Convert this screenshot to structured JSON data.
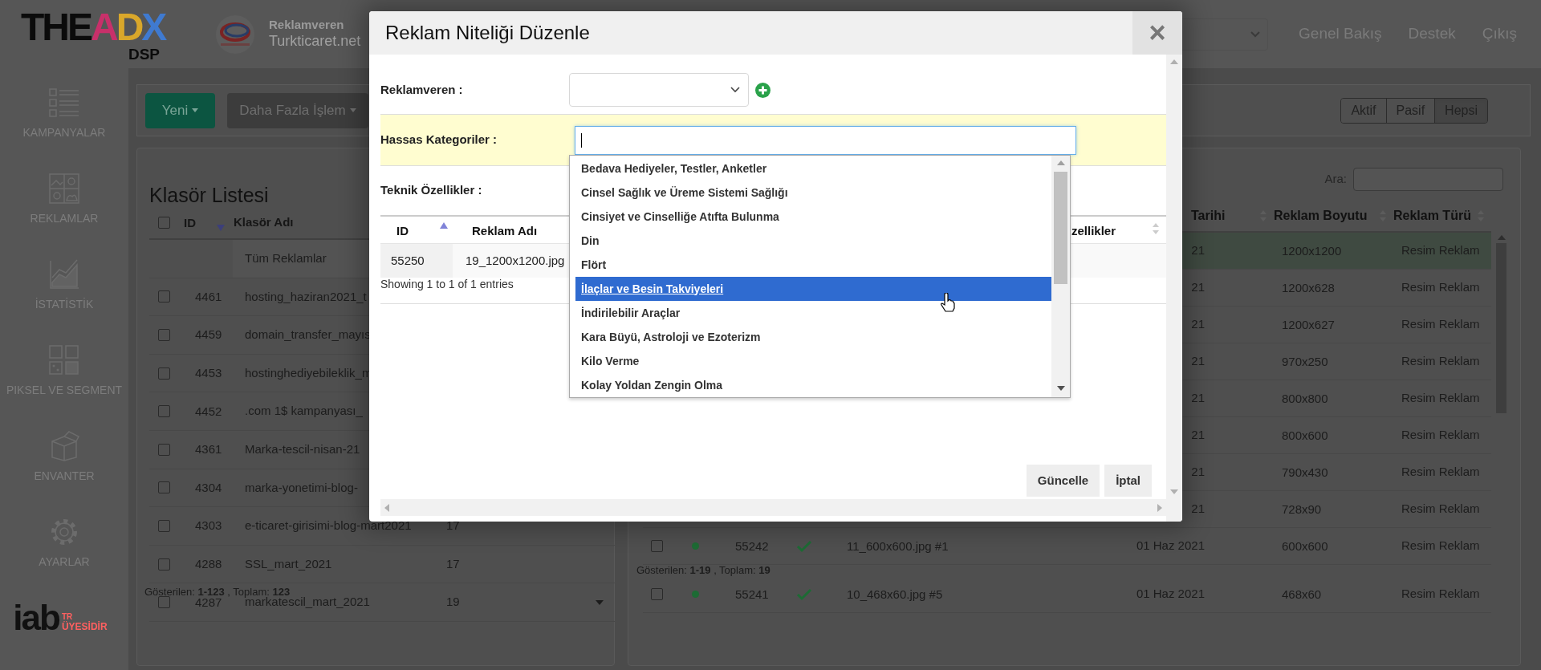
{
  "header": {
    "logo": "THEADX",
    "logo_sub": "DSP",
    "advertiser_caption": "Reklamveren",
    "advertiser_name": "Turkticaret.net",
    "nav": [
      "Genel Bakış",
      "Destek",
      "Çıkış"
    ]
  },
  "sidebar": {
    "items": [
      {
        "kind": "list",
        "label": "KAMPANYALAR"
      },
      {
        "kind": "images",
        "label": "REKLAMLAR"
      },
      {
        "kind": "chart",
        "label": "İSTATİSTİK"
      },
      {
        "kind": "grid",
        "label": "PIKSEL VE SEGMENT"
      },
      {
        "kind": "box",
        "label": "ENVANTER"
      },
      {
        "kind": "gear",
        "label": "AYARLAR"
      }
    ],
    "badge": {
      "brand": "iab",
      "country": "TR",
      "text": "ÜYESİDİR"
    }
  },
  "toolbar": {
    "new_button": "Yeni",
    "more_button": "Daha Fazla İşlem",
    "filters": [
      {
        "label": "Aktif",
        "selected": false
      },
      {
        "label": "Pasif",
        "selected": false
      },
      {
        "label": "Hepsi",
        "selected": true
      }
    ]
  },
  "folders": {
    "title": "Klasör Listesi",
    "select_all_checked": false,
    "columns": [
      "ID",
      "Klasör Adı"
    ],
    "rows": [
      {
        "name": "Tüm Reklamlar"
      },
      {
        "id": "4461",
        "name": "hosting_haziran2021_t",
        "checked": false
      },
      {
        "id": "4459",
        "name": "domain_transfer_mayıs",
        "checked": false
      },
      {
        "id": "4453",
        "name": "hostinghediyebileklik_m",
        "checked": false
      },
      {
        "id": "4452",
        "name": ".com 1$ kampanyası_",
        "checked": false
      },
      {
        "id": "4361",
        "name": "Marka-tescil-nisan-21",
        "checked": false
      },
      {
        "id": "4304",
        "name": "marka-yonetimi-blog-",
        "checked": false
      },
      {
        "id": "4303",
        "name": "e-ticaret-girisimi-blog-mart2021",
        "count": "17",
        "checked": false
      },
      {
        "id": "4288",
        "name": "SSL_mart_2021",
        "count": "17",
        "checked": false
      },
      {
        "id": "4287",
        "name": "markatescil_mart_2021",
        "count": "19",
        "checked": false
      }
    ],
    "footer": "Gösterilen: **1-123** , Toplam: **123**"
  },
  "ads": {
    "search_label": "Ara:",
    "columns": [
      "Tarihi",
      "Reklam Boyutu",
      "Reklam Türü"
    ],
    "rows": [
      {
        "date": "21",
        "size": "1200x1200",
        "type": "Resim Reklam",
        "highlighted": true
      },
      {
        "date": "21",
        "size": "1200x628",
        "type": "Resim Reklam",
        "highlighted": false
      },
      {
        "date": "21",
        "size": "1200x627",
        "type": "Resim Reklam",
        "highlighted": false
      },
      {
        "date": "21",
        "size": "970x250",
        "type": "Resim Reklam",
        "highlighted": false
      },
      {
        "date": "21",
        "size": "800x800",
        "type": "Resim Reklam",
        "highlighted": false
      },
      {
        "date": "21",
        "size": "800x600",
        "type": "Resim Reklam",
        "highlighted": false
      },
      {
        "date": "21",
        "size": "790x430",
        "type": "Resim Reklam",
        "highlighted": false
      },
      {
        "date": "21",
        "size": "728x90",
        "type": "Resim Reklam",
        "highlighted": false
      },
      {
        "checked": false,
        "active": true,
        "id": "55242",
        "approved": true,
        "name": "11_600x600.jpg #1",
        "date": "01 Haz 2021",
        "size": "600x600",
        "type": "Resim Reklam",
        "highlighted": false
      },
      {
        "checked": false,
        "active": true,
        "id": "55241",
        "approved": true,
        "name": "10_468x60.jpg #5",
        "date": "01 Haz 2021",
        "size": "468x60",
        "type": "Resim Reklam",
        "highlighted": false
      }
    ],
    "footer": "Gösterilen: **1-19** , Toplam: **19**"
  },
  "modal": {
    "title": "Reklam Niteliği Düzenle",
    "close": "×",
    "advertiser": {
      "label": "Reklamveren :"
    },
    "sensitive": {
      "label": "Hassas Kategoriler :",
      "options": [
        {
          "label": "Bedava Hediyeler, Testler, Anketler",
          "selected": false
        },
        {
          "label": "Cinsel Sağlık ve Üreme Sistemi Sağlığı",
          "selected": false
        },
        {
          "label": "Cinsiyet ve Cinselliğe Atıfta Bulunma",
          "selected": false
        },
        {
          "label": "Din",
          "selected": false
        },
        {
          "label": "Flört",
          "selected": false
        },
        {
          "label": "İlaçlar ve Besin Takviyeleri",
          "selected": true
        },
        {
          "label": "İndirilebilir Araçlar",
          "selected": false
        },
        {
          "label": "Kara Büyü, Astroloji ve Ezoterizm",
          "selected": false
        },
        {
          "label": "Kilo Verme",
          "selected": false
        },
        {
          "label": "Kolay Yoldan Zengin Olma",
          "selected": false
        }
      ]
    },
    "technical": {
      "label": "Teknik Özellikler :"
    },
    "table": {
      "columns": [
        "ID",
        "Reklam Adı",
        "zellikler"
      ],
      "rows": [
        {
          "id": "55250",
          "name": "19_1200x1200.jpg"
        }
      ],
      "info": "Showing 1 to 1 of 1 entries"
    },
    "buttons": [
      "Güncelle",
      "İptal"
    ]
  }
}
